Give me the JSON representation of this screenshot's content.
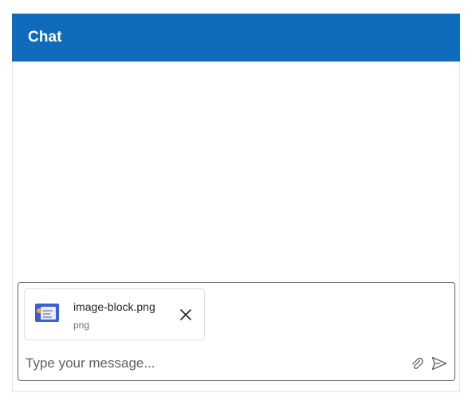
{
  "header": {
    "title": "Chat",
    "background_color": "#0f6cbd"
  },
  "composer": {
    "attachment": {
      "file_name": "image-block.png",
      "file_type": "png",
      "thumbnail_icon": "image-thumbnail-icon",
      "remove_icon": "close-icon"
    },
    "input": {
      "placeholder": "Type your message...",
      "value": ""
    },
    "attach_icon": "paperclip-icon",
    "send_icon": "send-icon"
  }
}
